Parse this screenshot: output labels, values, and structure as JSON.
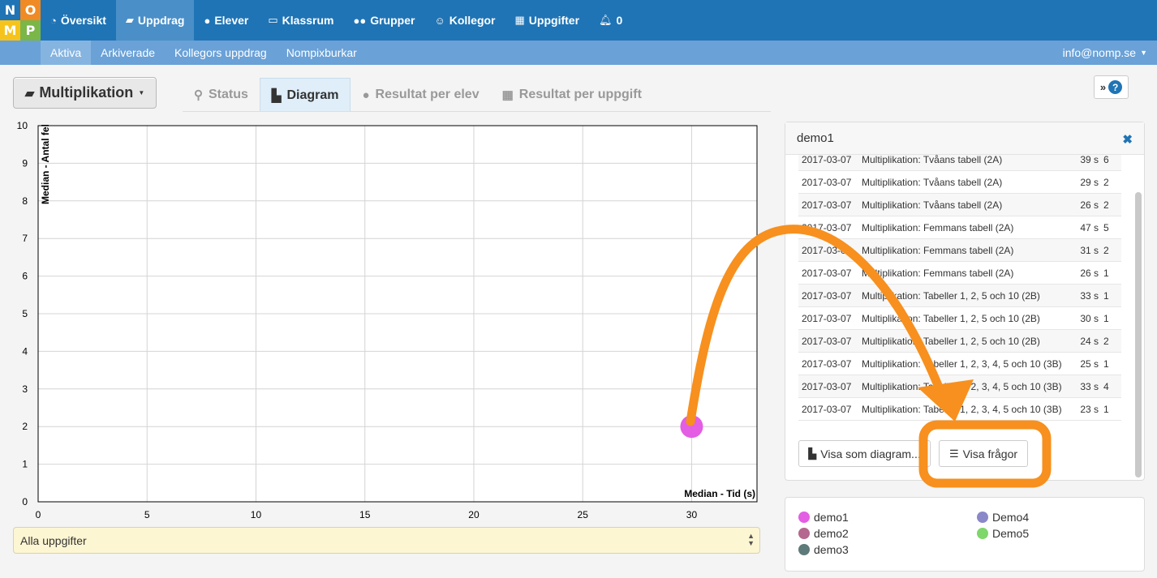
{
  "logo": {
    "letters": [
      "N",
      "O",
      "M",
      "P"
    ]
  },
  "topnav": {
    "items": [
      {
        "label": "Översikt",
        "icon": "dashboard-icon"
      },
      {
        "label": "Uppdrag",
        "icon": "book-icon",
        "active": true
      },
      {
        "label": "Elever",
        "icon": "user-icon"
      },
      {
        "label": "Klassrum",
        "icon": "monitor-icon"
      },
      {
        "label": "Grupper",
        "icon": "users-icon"
      },
      {
        "label": "Kollegor",
        "icon": "smile-icon"
      },
      {
        "label": "Uppgifter",
        "icon": "grid-icon"
      },
      {
        "label": "0",
        "icon": "bell-icon"
      }
    ]
  },
  "subnav": {
    "items": [
      {
        "label": "Aktiva",
        "active": true
      },
      {
        "label": "Arkiverade"
      },
      {
        "label": "Kollegors uppdrag"
      },
      {
        "label": "Nompixburkar"
      }
    ],
    "user": "info@nomp.se"
  },
  "task_dropdown": {
    "label": "Multiplikation"
  },
  "tabs": [
    {
      "label": "Status",
      "icon": "binoculars-icon"
    },
    {
      "label": "Diagram",
      "icon": "bar-chart-icon",
      "active": true
    },
    {
      "label": "Resultat per elev",
      "icon": "user-icon"
    },
    {
      "label": "Resultat per uppgift",
      "icon": "grid-icon"
    }
  ],
  "chart_data": {
    "type": "scatter",
    "xlabel": "Median - Tid (s)",
    "ylabel": "Median - Antal fel",
    "xlim": [
      0,
      33
    ],
    "ylim": [
      0,
      10
    ],
    "x_ticks": [
      0,
      5,
      10,
      15,
      20,
      25,
      30
    ],
    "y_ticks": [
      0,
      1,
      2,
      3,
      4,
      5,
      6,
      7,
      8,
      9,
      10
    ],
    "grid": true,
    "series": [
      {
        "name": "demo1",
        "color": "#e35ee3",
        "points": [
          {
            "x": 30,
            "y": 2
          }
        ]
      }
    ]
  },
  "filter": {
    "value": "Alla uppgifter"
  },
  "detail_panel": {
    "title": "demo1",
    "rows": [
      {
        "date": "2017-03-07",
        "task": "Multiplikation: Tvåans tabell (2A)",
        "time": "39 s",
        "errors": "6"
      },
      {
        "date": "2017-03-07",
        "task": "Multiplikation: Tvåans tabell (2A)",
        "time": "29 s",
        "errors": "2"
      },
      {
        "date": "2017-03-07",
        "task": "Multiplikation: Tvåans tabell (2A)",
        "time": "26 s",
        "errors": "2"
      },
      {
        "date": "2017-03-07",
        "task": "Multiplikation: Femmans tabell (2A)",
        "time": "47 s",
        "errors": "5"
      },
      {
        "date": "2017-03-07",
        "task": "Multiplikation: Femmans tabell (2A)",
        "time": "31 s",
        "errors": "2"
      },
      {
        "date": "2017-03-07",
        "task": "Multiplikation: Femmans tabell (2A)",
        "time": "26 s",
        "errors": "1"
      },
      {
        "date": "2017-03-07",
        "task": "Multiplikation: Tabeller 1, 2, 5 och 10 (2B)",
        "time": "33 s",
        "errors": "1"
      },
      {
        "date": "2017-03-07",
        "task": "Multiplikation: Tabeller 1, 2, 5 och 10 (2B)",
        "time": "30 s",
        "errors": "1"
      },
      {
        "date": "2017-03-07",
        "task": "Multiplikation: Tabeller 1, 2, 5 och 10 (2B)",
        "time": "24 s",
        "errors": "2"
      },
      {
        "date": "2017-03-07",
        "task": "Multiplikation: Tabeller 1, 2, 3, 4, 5 och 10 (3B)",
        "time": "25 s",
        "errors": "1"
      },
      {
        "date": "2017-03-07",
        "task": "Multiplikation: Tabeller 1, 2, 3, 4, 5 och 10 (3B)",
        "time": "33 s",
        "errors": "4"
      },
      {
        "date": "2017-03-07",
        "task": "Multiplikation: Tabeller 1, 2, 3, 4, 5 och 10 (3B)",
        "time": "23 s",
        "errors": "1"
      }
    ],
    "btn_diagram": "Visa som diagram...",
    "btn_questions": "Visa frågor"
  },
  "legend": [
    {
      "name": "demo1",
      "color": "#e35ee3"
    },
    {
      "name": "demo2",
      "color": "#b4678f"
    },
    {
      "name": "demo3",
      "color": "#5e7a7a"
    },
    {
      "name": "Demo4",
      "color": "#8a88c8"
    },
    {
      "name": "Demo5",
      "color": "#7fd66a"
    }
  ],
  "annotation": {
    "color": "#f7901e"
  }
}
